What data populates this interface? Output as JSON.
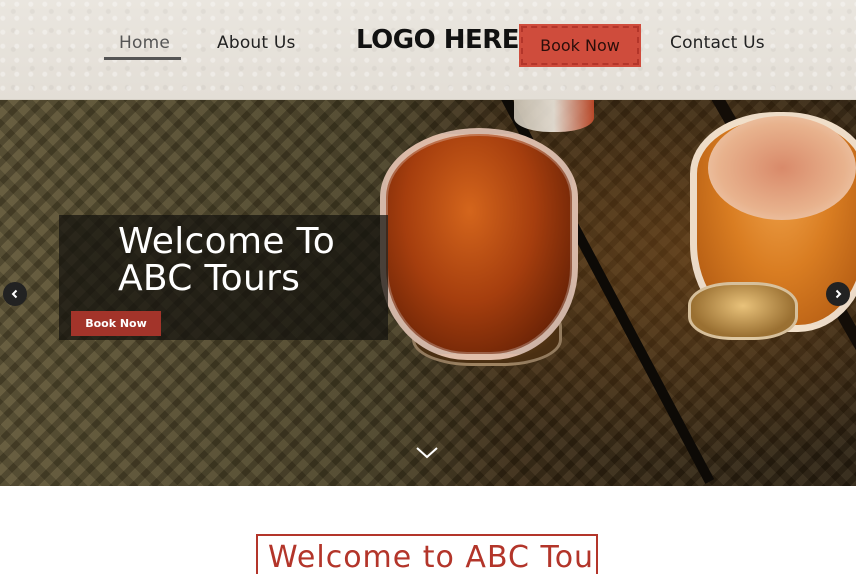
{
  "header": {
    "nav": {
      "home": "Home",
      "about": "About Us",
      "book": "Book Now",
      "contact": "Contact Us"
    },
    "logo": "LOGO HERE"
  },
  "hero": {
    "title_line1": "Welcome To",
    "title_line2": "ABC Tours",
    "book_button": "Book Now",
    "prev_icon": "chevron-left-icon",
    "next_icon": "chevron-right-icon",
    "scroll_icon": "chevron-down-icon"
  },
  "section": {
    "title": "Welcome to ABC Tours"
  },
  "colors": {
    "accent": "#cf4c3c",
    "button_dark": "#a3342a",
    "header_bg": "#e6e1d9"
  }
}
